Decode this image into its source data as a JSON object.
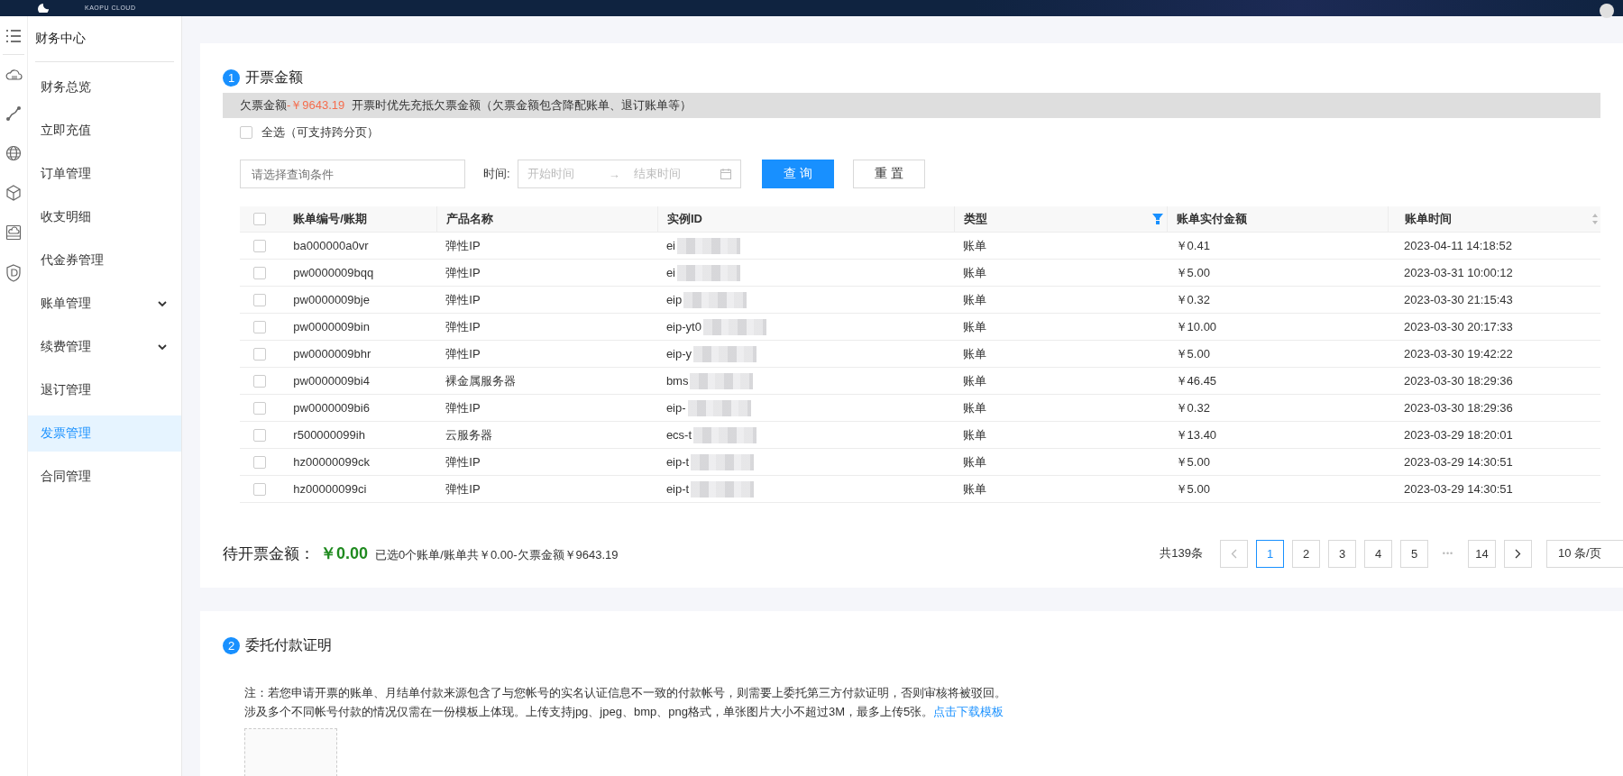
{
  "header": {
    "logo_text": "KAOPU CLOUD"
  },
  "sidebar": {
    "title": "财务中心",
    "items": [
      {
        "label": "财务总览",
        "expandable": false,
        "selected": false
      },
      {
        "label": "立即充值",
        "expandable": false,
        "selected": false
      },
      {
        "label": "订单管理",
        "expandable": false,
        "selected": false
      },
      {
        "label": "收支明细",
        "expandable": false,
        "selected": false
      },
      {
        "label": "代金券管理",
        "expandable": false,
        "selected": false
      },
      {
        "label": "账单管理",
        "expandable": true,
        "selected": false
      },
      {
        "label": "续费管理",
        "expandable": true,
        "selected": false
      },
      {
        "label": "退订管理",
        "expandable": false,
        "selected": false
      },
      {
        "label": "发票管理",
        "expandable": false,
        "selected": true
      },
      {
        "label": "合同管理",
        "expandable": false,
        "selected": false
      }
    ]
  },
  "section1": {
    "number": "1",
    "title": "开票金额",
    "notice": {
      "label": "欠票金额",
      "amount": "-￥9643.19",
      "text": "开票时优先充抵欠票金额（欠票金额包含降配账单、退订账单等）"
    },
    "select_all": {
      "label": "全选（可支持跨分页）",
      "checked": false
    },
    "filters": {
      "search_placeholder": "请选择查询条件",
      "time_label": "时间:",
      "start_placeholder": "开始时间",
      "range_separator": "→",
      "end_placeholder": "结束时间",
      "query_button": "查 询",
      "reset_button": "重 置"
    },
    "table": {
      "header_checked": false,
      "columns": [
        {
          "label": "账单编号/账期"
        },
        {
          "label": "产品名称"
        },
        {
          "label": "实例ID"
        },
        {
          "label": "类型",
          "filter": true
        },
        {
          "label": "账单实付金额"
        },
        {
          "label": "账单时间",
          "sort": true
        }
      ],
      "rows": [
        {
          "checked": false,
          "id": "ba000000a0vr",
          "product": "弹性IP",
          "instance": "ei",
          "type": "账单",
          "amount": "￥0.41",
          "time": "2023-04-11 14:18:52"
        },
        {
          "checked": false,
          "id": "pw0000009bqq",
          "product": "弹性IP",
          "instance": "ei",
          "type": "账单",
          "amount": "￥5.00",
          "time": "2023-03-31 10:00:12"
        },
        {
          "checked": false,
          "id": "pw0000009bje",
          "product": "弹性IP",
          "instance": "eip",
          "type": "账单",
          "amount": "￥0.32",
          "time": "2023-03-30 21:15:43"
        },
        {
          "checked": false,
          "id": "pw0000009bin",
          "product": "弹性IP",
          "instance": "eip-yt0",
          "type": "账单",
          "amount": "￥10.00",
          "time": "2023-03-30 20:17:33"
        },
        {
          "checked": false,
          "id": "pw0000009bhr",
          "product": "弹性IP",
          "instance": "eip-y",
          "type": "账单",
          "amount": "￥5.00",
          "time": "2023-03-30 19:42:22"
        },
        {
          "checked": false,
          "id": "pw0000009bi4",
          "product": "裸金属服务器",
          "instance": "bms",
          "type": "账单",
          "amount": "￥46.45",
          "time": "2023-03-30 18:29:36"
        },
        {
          "checked": false,
          "id": "pw0000009bi6",
          "product": "弹性IP",
          "instance": "eip-",
          "type": "账单",
          "amount": "￥0.32",
          "time": "2023-03-30 18:29:36"
        },
        {
          "checked": false,
          "id": "r500000099ih",
          "product": "云服务器",
          "instance": "ecs-t",
          "type": "账单",
          "amount": "￥13.40",
          "time": "2023-03-29 18:20:01"
        },
        {
          "checked": false,
          "id": "hz00000099ck",
          "product": "弹性IP",
          "instance": "eip-t",
          "type": "账单",
          "amount": "￥5.00",
          "time": "2023-03-29 14:30:51"
        },
        {
          "checked": false,
          "id": "hz00000099ci",
          "product": "弹性IP",
          "instance": "eip-t",
          "type": "账单",
          "amount": "￥5.00",
          "time": "2023-03-29 14:30:51"
        }
      ]
    },
    "summary": {
      "label": "待开票金额：",
      "amount": "￥0.00",
      "detail": "已选0个账单/账单共￥0.00-欠票金额￥9643.19"
    },
    "pagination": {
      "total": "共139条",
      "pages": [
        {
          "label": "1",
          "selected": true
        },
        {
          "label": "2",
          "selected": false
        },
        {
          "label": "3",
          "selected": false
        },
        {
          "label": "4",
          "selected": false
        },
        {
          "label": "5",
          "selected": false
        }
      ],
      "ellipsis": "•••",
      "last": {
        "label": "14",
        "selected": false
      },
      "size": "10 条/页"
    }
  },
  "section2": {
    "number": "2",
    "title": "委托付款证明",
    "note_lines": [
      "注：若您申请开票的账单、月结单付款来源包含了与您帐号的实名认证信息不一致的付款帐号，则需要上委托第三方付款证明，否则审核将被驳回。",
      "涉及多个不同帐号付款的情况仅需在一份模板上体现。上传支持jpg、jpeg、bmp、png格式，单张图片大小不超过3M，最多上传5张。"
    ],
    "link": "点击下载模板"
  }
}
